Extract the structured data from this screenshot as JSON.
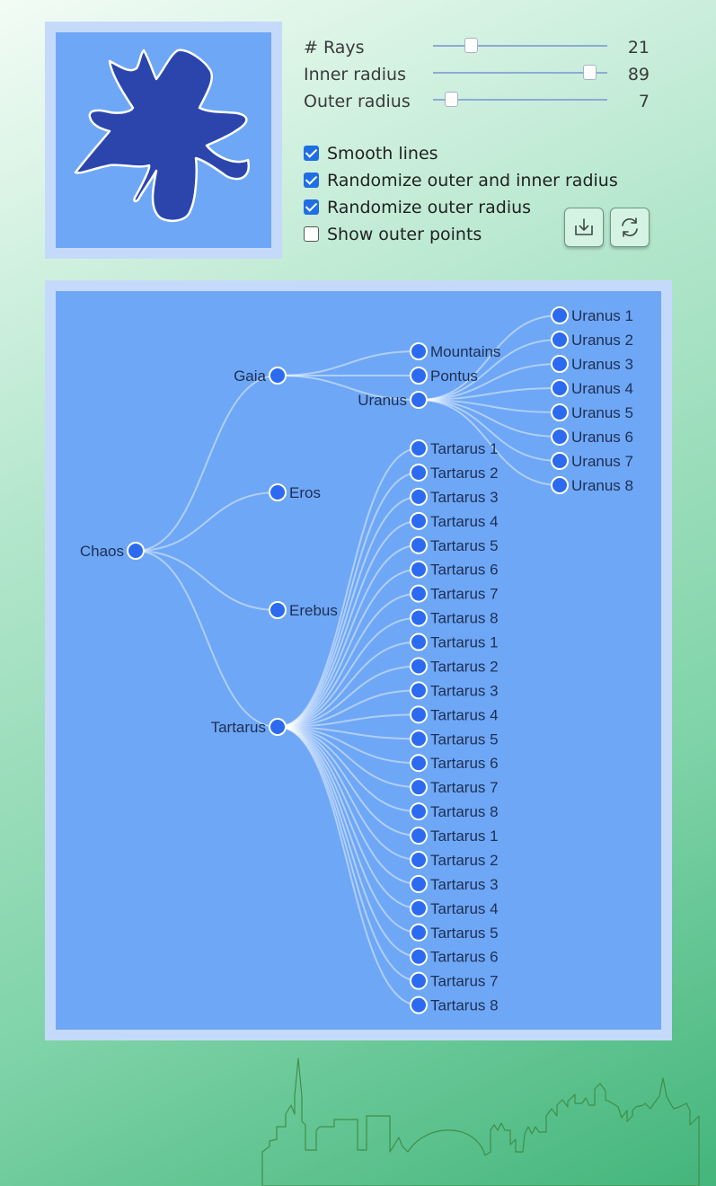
{
  "controls": {
    "sliders": [
      {
        "label": "# Rays",
        "value": "21",
        "fraction": 0.22
      },
      {
        "label": "Inner radius",
        "value": "89",
        "fraction": 0.9
      },
      {
        "label": "Outer radius",
        "value": "7",
        "fraction": 0.11
      }
    ],
    "checkboxes": [
      {
        "label": "Smooth lines",
        "checked": true
      },
      {
        "label": "Randomize outer and inner radius",
        "checked": true
      },
      {
        "label": "Randomize outer radius",
        "checked": true
      },
      {
        "label": "Show outer points",
        "checked": false
      }
    ],
    "buttons": {
      "download": "download-icon",
      "refresh": "refresh-icon"
    }
  },
  "colors": {
    "accent": "#1f6fe4",
    "panel": "#6ea7f6",
    "frame": "#c5dafb",
    "shape": "#2b45ad",
    "node_fill": "#2c6af0"
  },
  "tree": {
    "root": "Chaos",
    "children": [
      {
        "name": "Gaia",
        "children": [
          "Mountains",
          "Pontus",
          "Uranus"
        ]
      },
      {
        "name": "Eros"
      },
      {
        "name": "Erebus"
      },
      {
        "name": "Tartarus"
      }
    ],
    "uranus_children": [
      "Uranus 1",
      "Uranus 2",
      "Uranus 3",
      "Uranus 4",
      "Uranus 5",
      "Uranus 6",
      "Uranus 7",
      "Uranus 8"
    ],
    "tartarus_children": [
      "Tartarus 1",
      "Tartarus 2",
      "Tartarus 3",
      "Tartarus 4",
      "Tartarus 5",
      "Tartarus 6",
      "Tartarus 7",
      "Tartarus 8",
      "Tartarus 1",
      "Tartarus 2",
      "Tartarus 3",
      "Tartarus 4",
      "Tartarus 5",
      "Tartarus 6",
      "Tartarus 7",
      "Tartarus 8",
      "Tartarus 1",
      "Tartarus 2",
      "Tartarus 3",
      "Tartarus 4",
      "Tartarus 5",
      "Tartarus 6",
      "Tartarus 7",
      "Tartarus 8"
    ]
  }
}
